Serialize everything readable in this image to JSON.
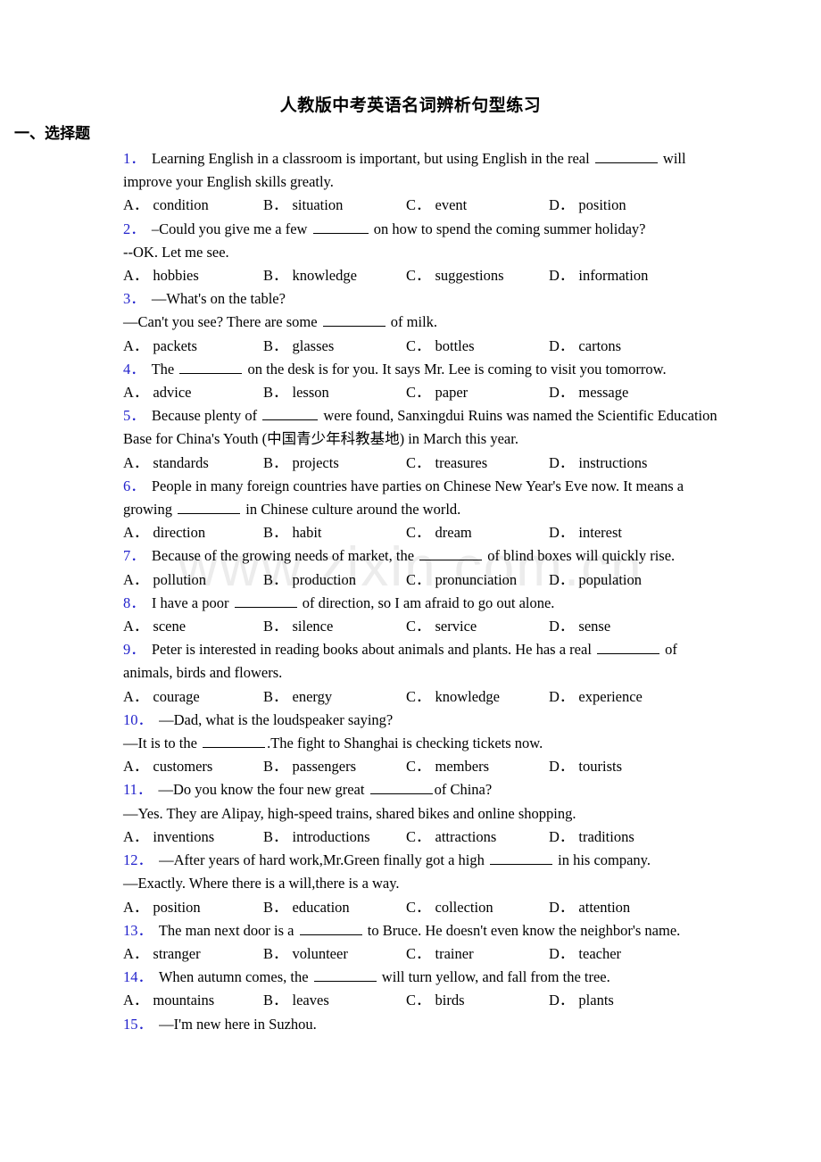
{
  "document": {
    "title": "人教版中考英语名词辨析句型练习",
    "section_heading": "一、选择题",
    "watermark": "www.zixin.com.cn"
  },
  "questions": [
    {
      "num": "1．",
      "lines": [
        "Learning English in a classroom is important, but using English in the real ________ will improve your English skills greatly."
      ],
      "options": [
        {
          "key": "A．",
          "text": "condition"
        },
        {
          "key": "B．",
          "text": "situation"
        },
        {
          "key": "C．",
          "text": "event"
        },
        {
          "key": "D．",
          "text": "position"
        }
      ]
    },
    {
      "num": "2．",
      "lines": [
        "–Could you give me a few ______ on how to spend the coming summer holiday?",
        "--OK. Let me see."
      ],
      "options": [
        {
          "key": "A．",
          "text": "hobbies"
        },
        {
          "key": "B．",
          "text": "knowledge"
        },
        {
          "key": "C．",
          "text": "suggestions"
        },
        {
          "key": "D．",
          "text": "information"
        }
      ]
    },
    {
      "num": "3．",
      "lines": [
        "—What's on the table?",
        "—Can't you see? There are some ________ of milk."
      ],
      "options": [
        {
          "key": "A．",
          "text": "packets"
        },
        {
          "key": "B．",
          "text": "glasses"
        },
        {
          "key": "C．",
          "text": "bottles"
        },
        {
          "key": "D．",
          "text": "cartons"
        }
      ]
    },
    {
      "num": "4．",
      "lines": [
        "The ________ on the desk is for you. It says Mr. Lee is coming to visit you tomorrow."
      ],
      "options": [
        {
          "key": "A．",
          "text": "advice"
        },
        {
          "key": "B．",
          "text": "lesson"
        },
        {
          "key": "C．",
          "text": "paper"
        },
        {
          "key": "D．",
          "text": "message"
        }
      ]
    },
    {
      "num": "5．",
      "lines": [
        "Because plenty of ______ were found, Sanxingdui Ruins was named the Scientific Education Base for China's Youth (中国青少年科教基地) in March this year."
      ],
      "options": [
        {
          "key": "A．",
          "text": "standards"
        },
        {
          "key": "B．",
          "text": "projects"
        },
        {
          "key": "C．",
          "text": "treasures"
        },
        {
          "key": "D．",
          "text": "instructions"
        }
      ]
    },
    {
      "num": "6．",
      "lines": [
        "People in many foreign countries have parties on Chinese New Year's Eve now. It means a growing ________ in Chinese culture around the world."
      ],
      "options": [
        {
          "key": "A．",
          "text": "direction"
        },
        {
          "key": "B．",
          "text": "habit"
        },
        {
          "key": "C．",
          "text": "dream"
        },
        {
          "key": "D．",
          "text": "interest"
        }
      ]
    },
    {
      "num": "7．",
      "lines": [
        "Because of the growing needs of market, the ________ of blind boxes will quickly rise."
      ],
      "options": [
        {
          "key": "A．",
          "text": "pollution"
        },
        {
          "key": "B．",
          "text": "production"
        },
        {
          "key": "C．",
          "text": "pronunciation"
        },
        {
          "key": "D．",
          "text": "population"
        }
      ]
    },
    {
      "num": "8．",
      "lines": [
        "I have a poor ________ of direction, so I am afraid to go out alone."
      ],
      "options": [
        {
          "key": "A．",
          "text": "scene"
        },
        {
          "key": "B．",
          "text": "silence"
        },
        {
          "key": "C．",
          "text": "service"
        },
        {
          "key": "D．",
          "text": "sense"
        }
      ]
    },
    {
      "num": "9．",
      "lines": [
        "Peter is interested in reading books about animals and plants. He has a real ________ of animals, birds and flowers."
      ],
      "options": [
        {
          "key": "A．",
          "text": "courage"
        },
        {
          "key": "B．",
          "text": "energy"
        },
        {
          "key": "C．",
          "text": "knowledge"
        },
        {
          "key": "D．",
          "text": "experience"
        }
      ]
    },
    {
      "num": "10．",
      "lines": [
        "—Dad, what is the loudspeaker saying?",
        "—It is to the ________.The fight to Shanghai is checking tickets now."
      ],
      "options": [
        {
          "key": "A．",
          "text": "customers"
        },
        {
          "key": "B．",
          "text": "passengers"
        },
        {
          "key": "C．",
          "text": "members"
        },
        {
          "key": "D．",
          "text": "tourists"
        }
      ]
    },
    {
      "num": "11．",
      "lines": [
        "—Do you know the four new great ________of China?",
        "—Yes. They are Alipay, high-speed trains, shared bikes and online shopping."
      ],
      "options": [
        {
          "key": "A．",
          "text": "inventions"
        },
        {
          "key": "B．",
          "text": "introductions"
        },
        {
          "key": "C．",
          "text": "attractions"
        },
        {
          "key": "D．",
          "text": "traditions"
        }
      ]
    },
    {
      "num": "12．",
      "lines": [
        "—After years of hard work,Mr.Green finally got a high ________ in his company.",
        "—Exactly. Where there is a will,there is a way."
      ],
      "options": [
        {
          "key": "A．",
          "text": "position"
        },
        {
          "key": "B．",
          "text": "education"
        },
        {
          "key": "C．",
          "text": "collection"
        },
        {
          "key": "D．",
          "text": "attention"
        }
      ]
    },
    {
      "num": "13．",
      "lines": [
        "The man next door is a ________ to Bruce. He doesn't even know the neighbor's name."
      ],
      "options": [
        {
          "key": "A．",
          "text": "stranger"
        },
        {
          "key": "B．",
          "text": "volunteer"
        },
        {
          "key": "C．",
          "text": "trainer"
        },
        {
          "key": "D．",
          "text": "teacher"
        }
      ]
    },
    {
      "num": "14．",
      "lines": [
        "When autumn comes, the ________ will turn yellow, and fall from the tree."
      ],
      "options": [
        {
          "key": "A．",
          "text": "mountains"
        },
        {
          "key": "B．",
          "text": "leaves"
        },
        {
          "key": "C．",
          "text": "birds"
        },
        {
          "key": "D．",
          "text": "plants"
        }
      ]
    },
    {
      "num": "15．",
      "lines": [
        "—I'm new here in Suzhou."
      ],
      "options": []
    }
  ]
}
